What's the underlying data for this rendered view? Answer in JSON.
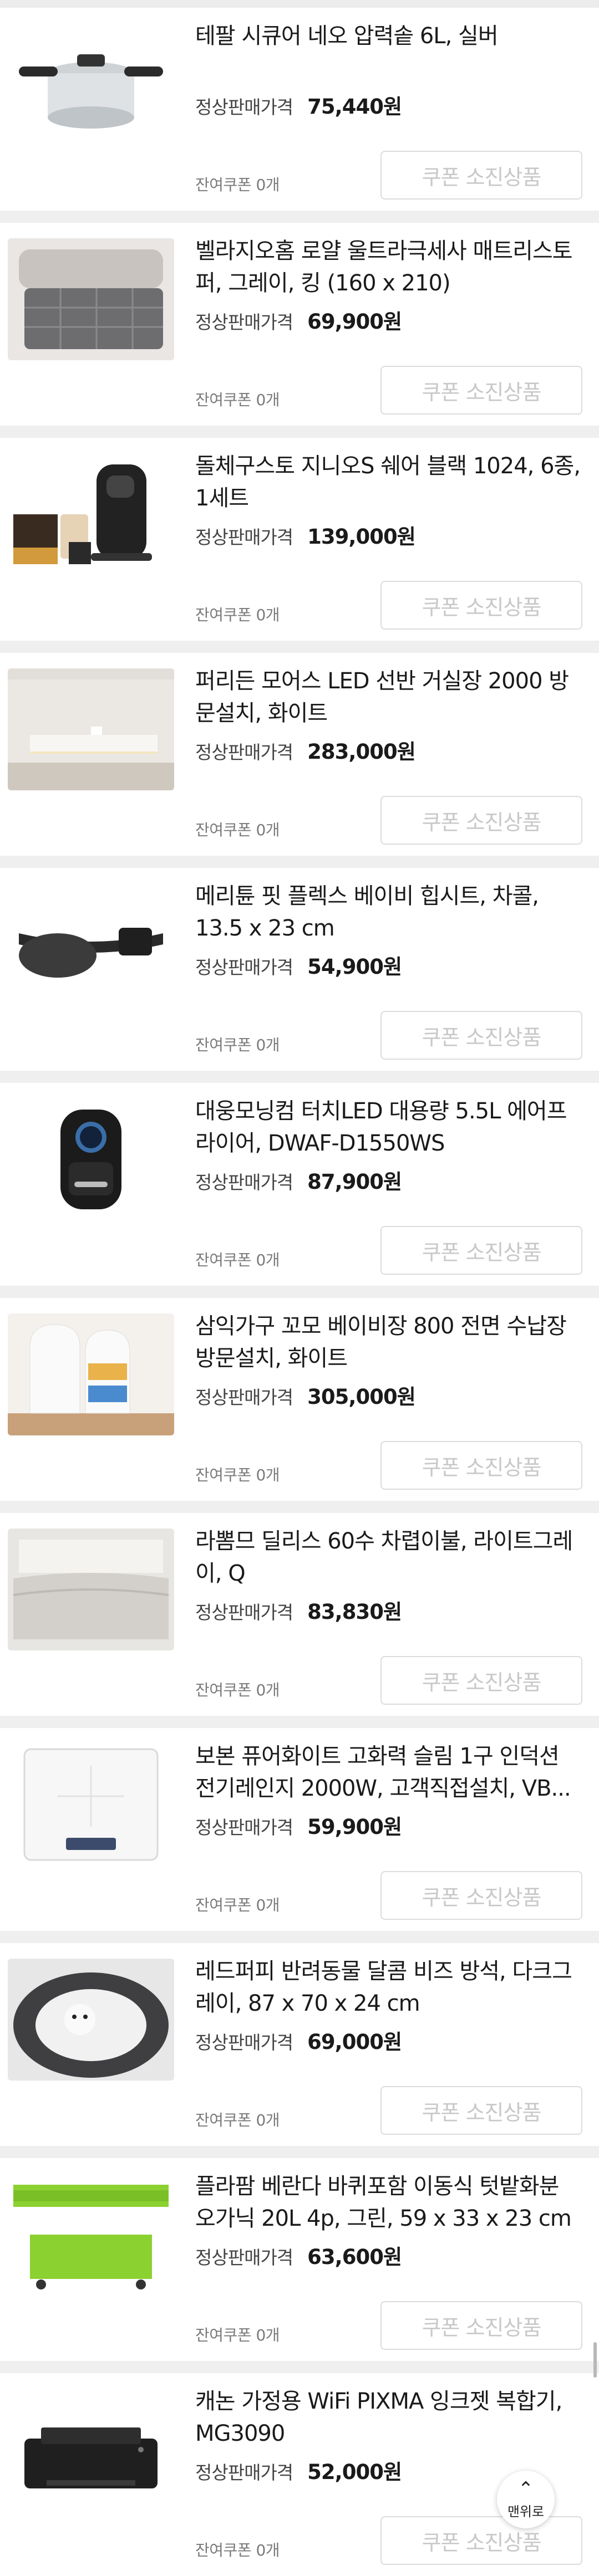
{
  "price_label": "정상판매가격",
  "coupon_button": "쿠폰 소진상품",
  "remaining_coupon": "잔여쿠폰 0개",
  "top_button": "맨위로",
  "items": [
    {
      "title": "테팔 시큐어 네오 압력솥 6L, 실버",
      "price": "75,440원",
      "icon": "pressure-cooker"
    },
    {
      "title": "벨라지오홈 로얄 울트라극세사 매트리스토퍼, 그레이, 킹 (160 x 210)",
      "price": "69,900원",
      "icon": "mattress-topper"
    },
    {
      "title": "돌체구스토 지니오S 쉐어 블랙 1024, 6종, 1세트",
      "price": "139,000원",
      "icon": "coffee-machine"
    },
    {
      "title": "퍼리든 모어스 LED 선반 거실장 2000 방문설치, 화이트",
      "price": "283,000원",
      "icon": "tv-cabinet"
    },
    {
      "title": "메리튠 핏 플렉스 베이비 힙시트, 차콜, 13.5 x 23 cm",
      "price": "54,900원",
      "icon": "hip-seat"
    },
    {
      "title": "대웅모닝컴 터치LED 대용량 5.5L 에어프라이어, DWAF-D1550WS",
      "price": "87,900원",
      "icon": "air-fryer"
    },
    {
      "title": "삼익가구 꼬모 베이비장 800 전면 수납장 방문설치, 화이트",
      "price": "305,000원",
      "icon": "baby-cabinet"
    },
    {
      "title": "라뽐므 딜리스 60수 차렵이불, 라이트그레이, Q",
      "price": "83,830원",
      "icon": "comforter"
    },
    {
      "title": "보본 퓨어화이트 고화력 슬림 1구 인덕션 전기레인지 2000W, 고객직접설치, VB...",
      "price": "59,900원",
      "icon": "induction-cooker"
    },
    {
      "title": "레드퍼피 반려동물 달콤 비즈 방석, 다크그레이, 87 x 70 x 24 cm",
      "price": "69,000원",
      "icon": "pet-cushion"
    },
    {
      "title": "플라팜 베란다 바퀴포함 이동식 텃밭화분 오가닉 20L 4p, 그린, 59 x 33 x 23 cm",
      "price": "63,600원",
      "icon": "planter-box"
    },
    {
      "title": "캐논 가정용 WiFi PIXMA 잉크젯 복합기, MG3090",
      "price": "52,000원",
      "icon": "printer"
    }
  ]
}
